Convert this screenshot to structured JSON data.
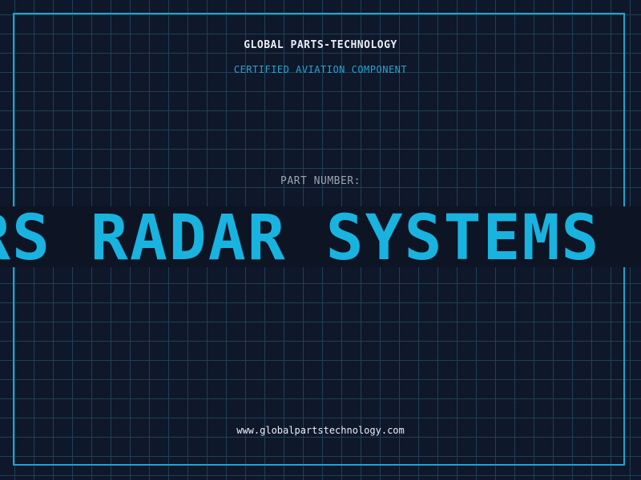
{
  "header": {
    "brand": "GLOBAL PARTS-TECHNOLOGY",
    "subtitle": "CERTIFIED AVIATION COMPONENT"
  },
  "part": {
    "label": "PART NUMBER:",
    "value": "RS RADAR SYSTEMS L"
  },
  "footer": {
    "url": "www.globalpartstechnology.com"
  },
  "colors": {
    "background": "#0f172a",
    "grid": "#1e4156",
    "frame": "#16a7d3",
    "accent": "#19b3e0",
    "text": "#e9eef5",
    "muted": "#9aa3af"
  }
}
